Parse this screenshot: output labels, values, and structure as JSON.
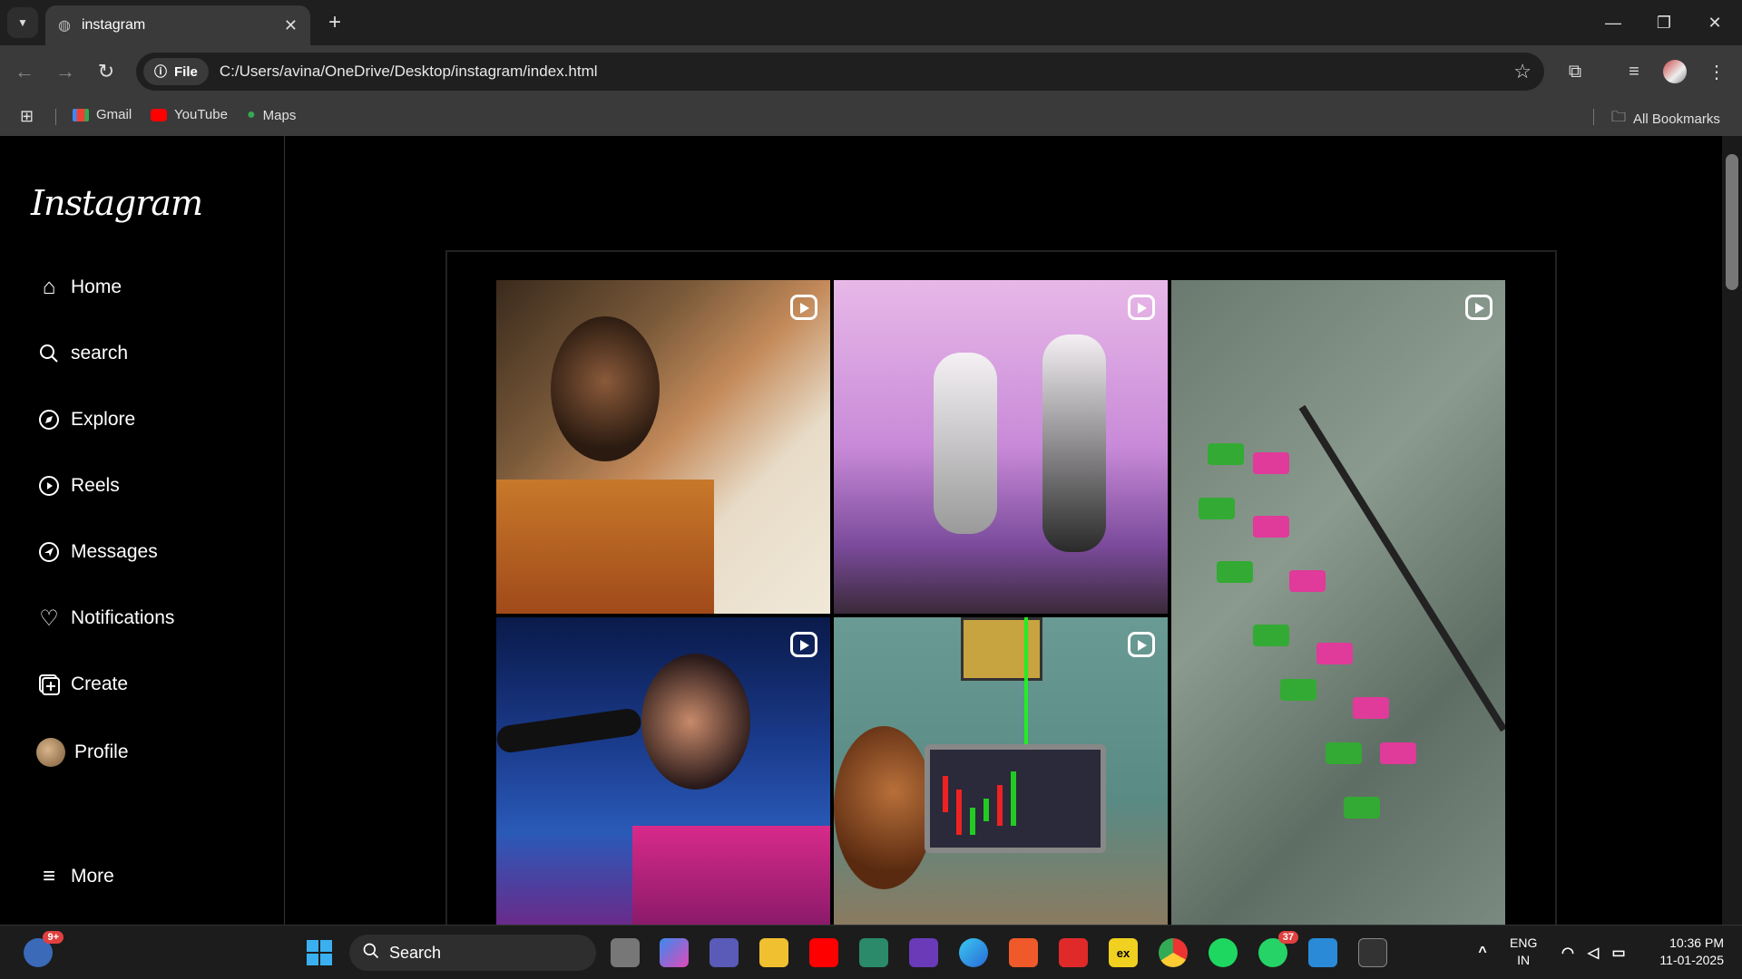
{
  "browser": {
    "tab_title": "instagram",
    "url_chip": "File",
    "url": "C:/Users/avina/OneDrive/Desktop/instagram/index.html",
    "bookmarks": [
      "Gmail",
      "YouTube",
      "Maps"
    ],
    "all_bookmarks": "All Bookmarks"
  },
  "sidebar": {
    "logo": "Instagram",
    "items": [
      {
        "label": "Home",
        "icon": "home-icon"
      },
      {
        "label": "search",
        "icon": "search-icon"
      },
      {
        "label": "Explore",
        "icon": "compass-icon"
      },
      {
        "label": "Reels",
        "icon": "reels-icon"
      },
      {
        "label": "Messages",
        "icon": "send-icon"
      },
      {
        "label": "Notifications",
        "icon": "heart-icon"
      },
      {
        "label": "Create",
        "icon": "plus-square-icon"
      },
      {
        "label": "Profile",
        "icon": "avatar"
      }
    ],
    "more": "More"
  },
  "taskbar": {
    "search_label": "Search",
    "widget_badge": "9+",
    "whatsapp_badge": "37",
    "lang_line1": "ENG",
    "lang_line2": "IN",
    "time": "10:36 PM",
    "date": "11-01-2025"
  },
  "colors": {
    "chrome_dark": "#1f1f1f",
    "chrome_toolbar": "#3a3a3a",
    "page_bg": "#000000"
  }
}
